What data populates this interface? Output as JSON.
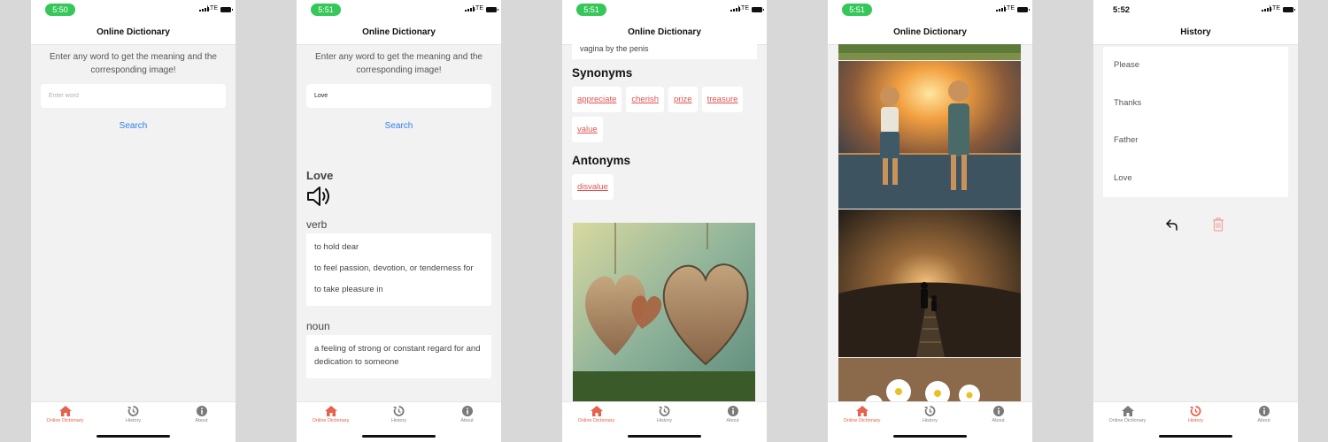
{
  "colors": {
    "page_bg": "#d8d8d8",
    "accent": "#e8614c",
    "link": "#2f80ed",
    "chip_text": "#e05252"
  },
  "screens": [
    {
      "time": "5:50",
      "time_style": "pill",
      "network": "LTE",
      "title": "Online Dictionary",
      "active_tab": 0
    },
    {
      "time": "5:51",
      "time_style": "pill",
      "network": "LTE",
      "title": "Online Dictionary",
      "active_tab": 0
    },
    {
      "time": "5:51",
      "time_style": "pill",
      "network": "LTE",
      "title": "Online Dictionary",
      "active_tab": 0
    },
    {
      "time": "5:51",
      "time_style": "pill",
      "network": "LTE",
      "title": "Online Dictionary",
      "active_tab": 0
    },
    {
      "time": "5:52",
      "time_style": "plain",
      "network": "LTE",
      "title": "History",
      "active_tab": 1
    }
  ],
  "search": {
    "intro": "Enter any word to get the meaning and the corresponding image!",
    "placeholder": "Enter word",
    "button_label": "Search",
    "entered_value": "Love"
  },
  "result": {
    "word": "Love",
    "speaker_icon": "speaker-icon",
    "senses": [
      {
        "part_of_speech": "verb",
        "definitions": [
          "to hold dear",
          "to feel passion, devotion, or tenderness for",
          "to take pleasure in"
        ]
      },
      {
        "part_of_speech": "noun",
        "definitions": [
          "a feeling of strong or constant regard for and dedication to someone"
        ]
      }
    ],
    "partial_definition": "vagina by the penis",
    "synonyms_title": "Synonyms",
    "synonyms": [
      "appreciate",
      "cherish",
      "prize",
      "treasure",
      "value"
    ],
    "antonyms_title": "Antonyms",
    "antonyms": [
      "disvalue"
    ]
  },
  "history": {
    "items": [
      "Please",
      "Thanks",
      "Father",
      "Love"
    ],
    "undo_icon": "undo-icon",
    "delete_icon": "trash-icon"
  },
  "tabs": [
    {
      "label": "Online Dictionary",
      "icon": "home-icon"
    },
    {
      "label": "History",
      "icon": "history-icon"
    },
    {
      "label": "About",
      "icon": "info-icon"
    }
  ]
}
